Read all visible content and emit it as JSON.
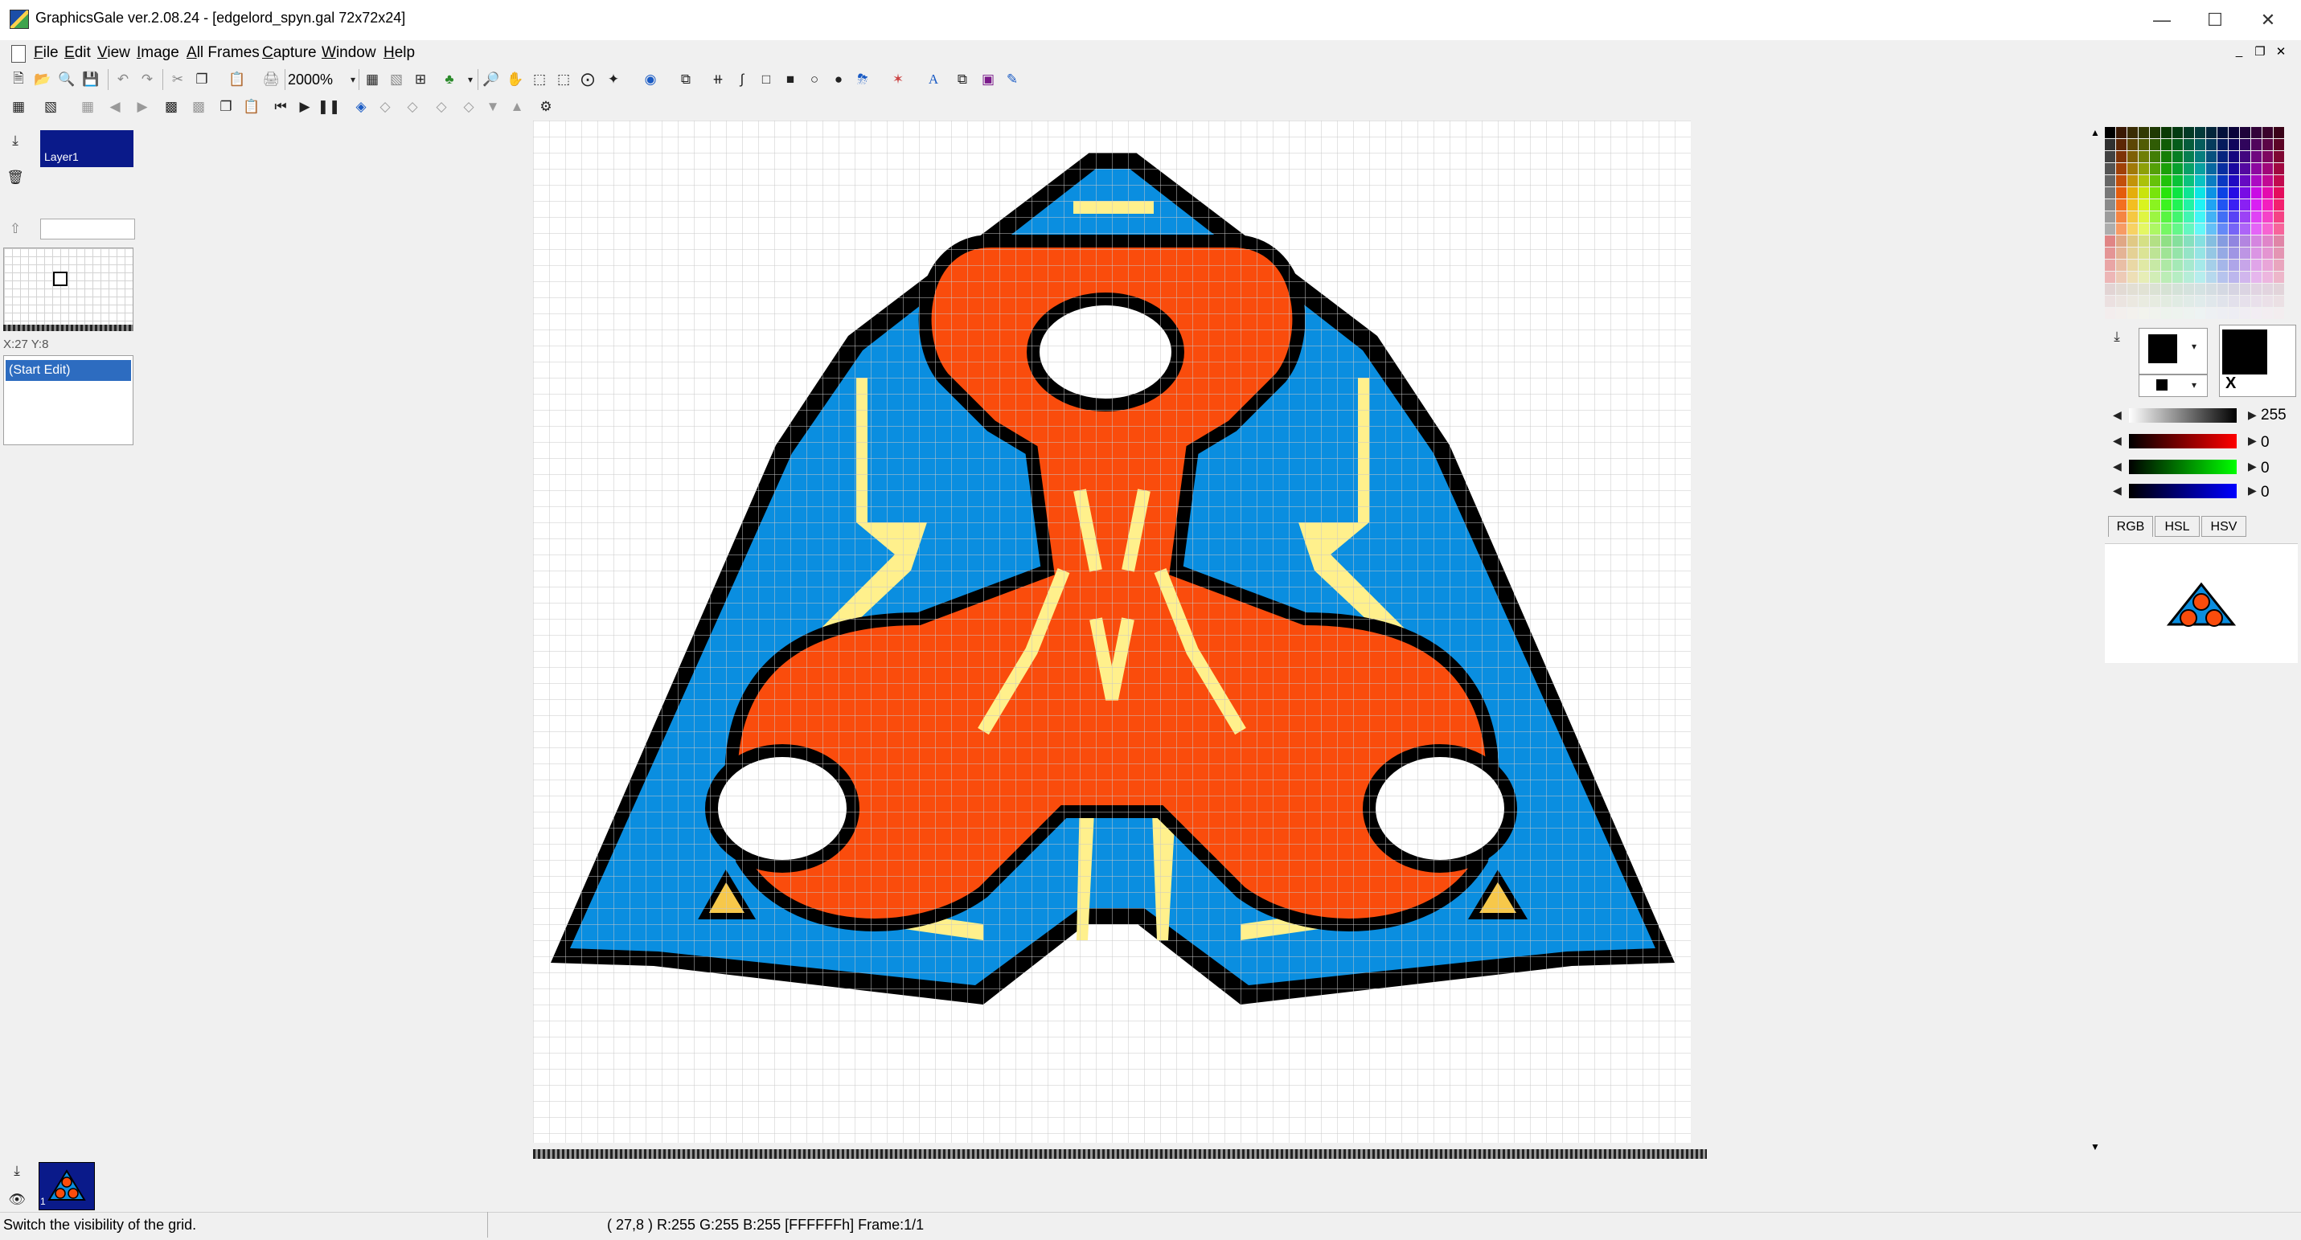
{
  "window": {
    "title": "GraphicsGale ver.2.08.24 - [edgelord_spyn.gal 72x72x24]",
    "minimize_icon": "minimize-icon",
    "maximize_icon": "maximize-icon",
    "close_icon": "close-icon"
  },
  "menubar": {
    "items": [
      "File",
      "Edit",
      "View",
      "Image",
      "All Frames",
      "Capture",
      "Window",
      "Help"
    ]
  },
  "toolbar": {
    "zoom": "2000%",
    "icons": [
      "new-icon",
      "open-icon",
      "browse-icon",
      "save-icon",
      "undo-icon",
      "redo-icon",
      "cut-icon",
      "copy-icon",
      "paste-icon",
      "print-icon",
      "grid-icon",
      "pixel-grid-icon",
      "fit-icon",
      "tree-icon",
      "magnifier-icon",
      "hand-icon",
      "select-rect-icon",
      "select-free-icon",
      "lasso-icon",
      "magic-wand-icon",
      "eyedropper-icon",
      "stamp-icon",
      "line-icon",
      "curve-icon",
      "rect-outline-icon",
      "rect-fill-icon",
      "ellipse-outline-icon",
      "ellipse-fill-icon",
      "fill-icon",
      "gradient-icon",
      "text-icon",
      "transform-icon",
      "display-icon",
      "pen-icon"
    ]
  },
  "layers": {
    "name": "Layer1"
  },
  "navigator": {
    "coords": "X:27 Y:8"
  },
  "history": {
    "items": [
      "(Start Edit)"
    ]
  },
  "colors": {
    "accent": "#2d6cc0",
    "sprite_black": "#000000",
    "sprite_blue": "#0a8ee0",
    "sprite_orange": "#fa4c0c",
    "sprite_yellow": "#fff08c",
    "sprite_gold": "#f7c84a"
  },
  "color_panel": {
    "gray_value": "255",
    "red_value": "0",
    "green_value": "0",
    "blue_value": "0",
    "tabs": [
      "RGB",
      "HSL",
      "HSV"
    ],
    "swap_label": "X"
  },
  "frames": {
    "index": "1"
  },
  "status": {
    "hint": "Switch the visibility of the grid.",
    "pixel_info": "( 27,8 ) R:255 G:255 B:255  [FFFFFFh]  Frame:1/1"
  }
}
